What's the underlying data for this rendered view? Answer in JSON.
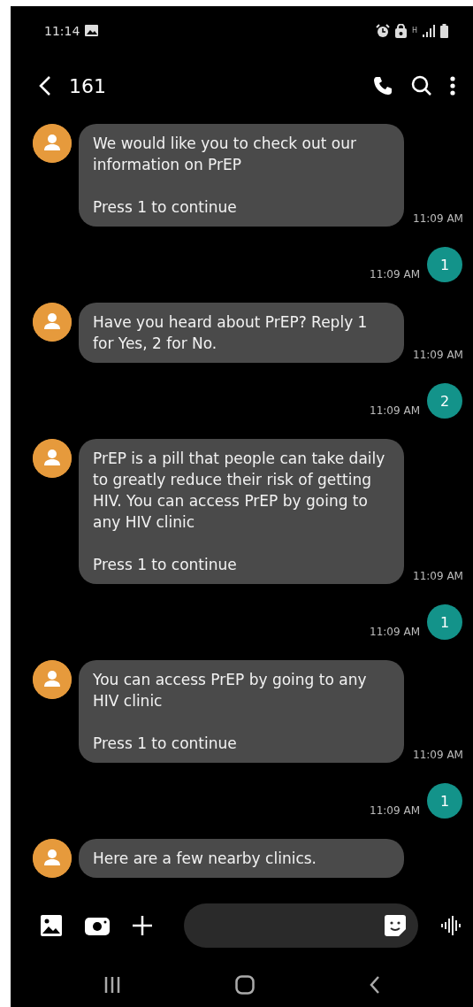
{
  "status_bar": {
    "time": "11:14",
    "network": "H"
  },
  "header": {
    "title": "161"
  },
  "messages": [
    {
      "kind": "incoming",
      "text": "We would like you to check out our information on PrEP\n\nPress 1 to continue",
      "time": "11:09 AM"
    },
    {
      "kind": "outgoing",
      "text": "1",
      "time": "11:09 AM"
    },
    {
      "kind": "incoming",
      "text": "Have you heard about PrEP? Reply 1 for Yes, 2 for No.",
      "time": "11:09 AM"
    },
    {
      "kind": "outgoing",
      "text": "2",
      "time": "11:09 AM"
    },
    {
      "kind": "incoming",
      "text": "PrEP is a pill that people can take daily to greatly reduce their risk of getting HIV. You can access PrEP by going to any HIV clinic\n\nPress 1 to continue",
      "time": "11:09 AM"
    },
    {
      "kind": "outgoing",
      "text": "1",
      "time": "11:09 AM"
    },
    {
      "kind": "incoming",
      "text": "You can access PrEP by going to any HIV clinic\n\nPress 1 to continue",
      "time": "11:09 AM"
    },
    {
      "kind": "outgoing",
      "text": "1",
      "time": "11:09 AM"
    },
    {
      "kind": "incoming",
      "text": "Here are a few nearby clinics."
    }
  ]
}
